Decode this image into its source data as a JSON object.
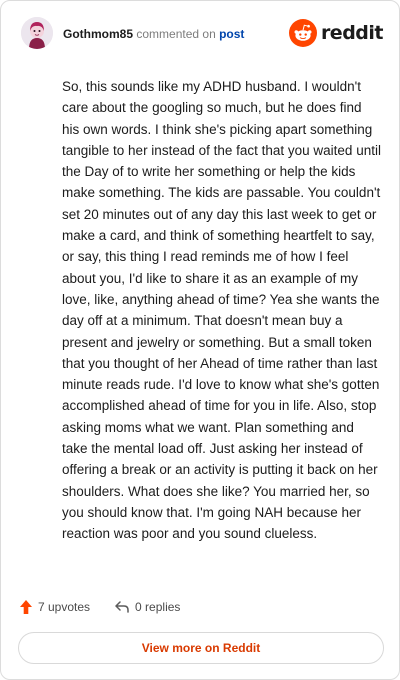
{
  "comment": {
    "author": "Gothmom85",
    "action_text": "commented on",
    "post_link_text": "post",
    "body": "So, this sounds like my ADHD husband. I wouldn't care about the googling so much, but he does find his own words. I think she's picking apart something tangible to her instead of the fact that you waited until the Day of to write her something or help the kids make something. The kids are passable. You couldn't set 20 minutes out of any day this last week to get or make a card, and think of something heartfelt to say, or say, this thing I read reminds me of how I feel about you, I'd like to share it as an example of my love, like, anything ahead of time? Yea she wants the day off at a minimum. That doesn't mean buy a present and jewelry or something. But a small token that you thought of her Ahead of time rather than last minute reads rude. I'd love to know what she's gotten accomplished ahead of time for you in life. Also, stop asking moms what we want. Plan something and take the mental load off. Just asking her instead of offering a break or an activity is putting it back on her shoulders. What does she like? You married her, so you should know that. I'm going NAH because her reaction was poor and you sound clueless."
  },
  "brand": {
    "wordmark": "reddit",
    "icon": "reddit-snoo-icon",
    "accent_color": "#ff4500"
  },
  "stats": {
    "upvotes_label": "7 upvotes",
    "upvote_icon": "upvote-arrow-icon",
    "upvote_color": "#ff4500",
    "replies_label": "0 replies",
    "reply_icon": "reply-arrow-icon"
  },
  "footer": {
    "view_more_label": "View more on Reddit",
    "link_color": "#d93a00"
  }
}
